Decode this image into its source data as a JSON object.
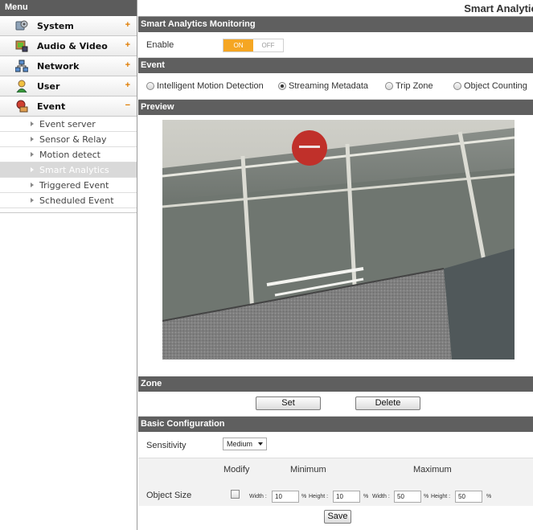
{
  "sidebar": {
    "header": "Menu",
    "items": [
      {
        "label": "System",
        "icon": "system-gear-icon",
        "toggle": "+"
      },
      {
        "label": "Audio & Video",
        "icon": "camera-icon",
        "toggle": "+"
      },
      {
        "label": "Network",
        "icon": "network-icon",
        "toggle": "+"
      },
      {
        "label": "User",
        "icon": "user-icon",
        "toggle": "+"
      },
      {
        "label": "Event",
        "icon": "event-icon",
        "toggle": "−"
      }
    ],
    "subitems": [
      "Event server",
      "Sensor & Relay",
      "Motion detect",
      "Smart Analytics",
      "Triggered Event",
      "Scheduled Event"
    ],
    "active_subitem": "Smart Analytics"
  },
  "main": {
    "page_title": "Smart Analytics",
    "monitoring": {
      "header": "Smart Analytics Monitoring",
      "enable_label": "Enable",
      "on_label": "ON",
      "off_label": "OFF",
      "value": "ON"
    },
    "event": {
      "header": "Event",
      "options": [
        "Intelligent Motion Detection",
        "Streaming Metadata",
        "Trip Zone",
        "Object Counting"
      ],
      "selected": "Streaming Metadata"
    },
    "preview": {
      "header": "Preview"
    },
    "zone": {
      "header": "Zone",
      "set_label": "Set",
      "delete_label": "Delete"
    },
    "basic": {
      "header": "Basic Configuration",
      "sensitivity_label": "Sensitivity",
      "sensitivity_value": "Medium",
      "modify_label": "Modify",
      "minimum_label": "Minimum",
      "maximum_label": "Maximum",
      "object_size_label": "Object Size",
      "width_label": "Width :",
      "height_label": "Height :",
      "percent": "%",
      "min_width": "10",
      "min_height": "10",
      "max_width": "50",
      "max_height": "50",
      "modify_checked": false,
      "save_label": "Save"
    }
  },
  "colors": {
    "section_header": "#5f5f5f",
    "toggle_on": "#f5a623",
    "active_subitem": "#d9d9d9"
  }
}
